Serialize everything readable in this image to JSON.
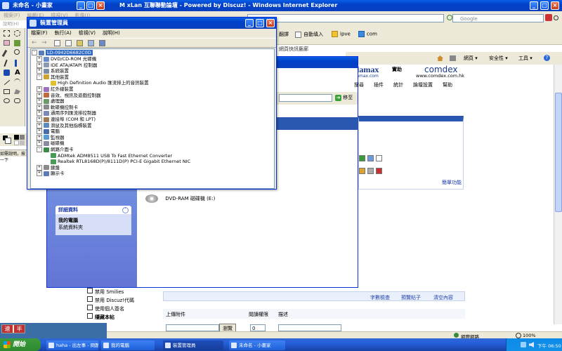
{
  "paint": {
    "title": "未命名 - 小畫家",
    "menu": [
      "檔案(F)",
      "編輯(E)",
      "檢視(V)",
      "影像(I)",
      "色彩(C)",
      "說明(H)"
    ],
    "status": "如需說明，按一下"
  },
  "ie": {
    "title": "M xLan 互聯聯動論壇 - Powered by Discuz! - Windows Internet Explorer",
    "search_placeholder": "Google",
    "toolbar": [
      "翻譯",
      "自動填入",
      "ipve",
      "com"
    ],
    "links_item": "網頁快訊藝廊",
    "cmd": [
      "網頁",
      "安全性",
      "工具"
    ],
    "banner": {
      "brand": "olamax",
      "sub": "olamax.com",
      "tag": "實助",
      "comdex": "comdex",
      "comdex_url": "www.comdex.com.hk"
    },
    "nav": [
      "搜尋",
      "插件",
      "統計",
      "論壇設置",
      "幫助"
    ],
    "go_button": "移至",
    "simple_features": "簡單功能",
    "options": [
      "禁用 Smilies",
      "禁用 Discuz!代碼",
      "使用個人簽名",
      "隱藏本帖"
    ],
    "links_row": [
      "字數檢查",
      "預覽帖子",
      "清空內容"
    ],
    "upload": {
      "attach": "上傳附件",
      "perm": "閱讀權限",
      "desc": "描述",
      "browse": "瀏覽",
      "perm_value": "0"
    },
    "status_zone": "網際網路",
    "zoom": "100%"
  },
  "explorer": {
    "detail_header": "詳細資料",
    "detail_title": "我的電腦",
    "detail_sub": "系統資料夾",
    "drive": "DVD-RAM 磁碟機 (E:)"
  },
  "devmgr": {
    "title": "裝置管理員",
    "menu": [
      "檔案(F)",
      "執行(A)",
      "檢視(V)",
      "說明(H)"
    ],
    "root": "LD-0942D6682C0D",
    "tree": [
      {
        "label": "DVD/CD-ROM 光碟機",
        "level": 1,
        "exp": "+"
      },
      {
        "label": "IDE ATA/ATAPI 控制器",
        "level": 1,
        "exp": "+"
      },
      {
        "label": "系統裝置",
        "level": 1,
        "exp": "+"
      },
      {
        "label": "其他裝置",
        "level": 1,
        "exp": "-"
      },
      {
        "label": "High Definition Audio 匯流排上的音訊裝置",
        "level": 2,
        "exp": ""
      },
      {
        "label": "紅外線裝置",
        "level": 1,
        "exp": "+"
      },
      {
        "label": "音效、視訊及遊戲控制器",
        "level": 1,
        "exp": "+"
      },
      {
        "label": "處理器",
        "level": 1,
        "exp": "+"
      },
      {
        "label": "軟碟機控制卡",
        "level": 1,
        "exp": "+"
      },
      {
        "label": "通用序列匯流排控制器",
        "level": 1,
        "exp": "+"
      },
      {
        "label": "連接埠 (COM 和 LPT)",
        "level": 1,
        "exp": "+"
      },
      {
        "label": "滑鼠及其他指標裝置",
        "level": 1,
        "exp": "+"
      },
      {
        "label": "電腦",
        "level": 1,
        "exp": "+"
      },
      {
        "label": "監視器",
        "level": 1,
        "exp": "+"
      },
      {
        "label": "磁碟機",
        "level": 1,
        "exp": "+"
      },
      {
        "label": "網路介面卡",
        "level": 1,
        "exp": "-"
      },
      {
        "label": "ADMtek ADM8511 USB To Fast Ethernet Converter",
        "level": 2,
        "exp": ""
      },
      {
        "label": "Realtek RTL8168D(P)/8111D(P) PCI-E Gigabit Ethernet NIC",
        "level": 2,
        "exp": ""
      },
      {
        "label": "鍵盤",
        "level": 1,
        "exp": "+"
      },
      {
        "label": "顯示卡",
        "level": 1,
        "exp": "+"
      }
    ]
  },
  "taskbar": {
    "start": "開始",
    "tasks": [
      "haha - 出左事 - 問題...",
      "我的電腦",
      "裝置管理員",
      "未命名 - 小畫家"
    ],
    "clock": "下午 06:50",
    "ime": [
      "速",
      "半"
    ]
  }
}
